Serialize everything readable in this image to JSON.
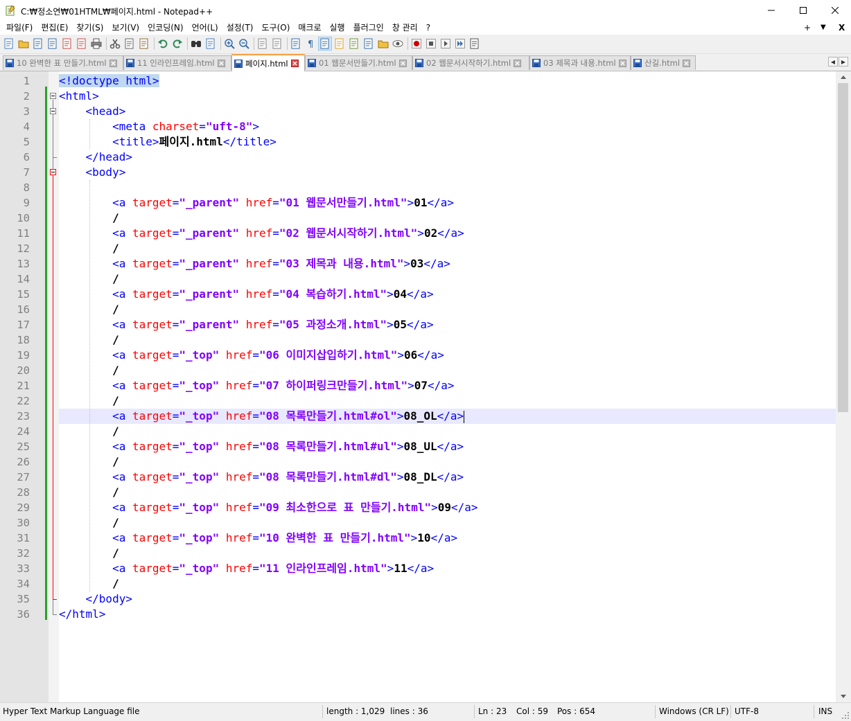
{
  "window": {
    "title": "C:₩정소연₩01HTML₩페이지.html - Notepad++",
    "icon": "notepad-icon"
  },
  "menu": {
    "items": [
      "파일(F)",
      "편집(E)",
      "찾기(S)",
      "보기(V)",
      "인코딩(N)",
      "언어(L)",
      "설정(T)",
      "도구(O)",
      "매크로",
      "실행",
      "플러그인",
      "창 관리",
      "?"
    ],
    "right_plus": "+",
    "right_arrow": "▼",
    "right_close": "X"
  },
  "toolbar": {
    "icons": [
      "new-file-icon",
      "open-file-icon",
      "save-icon",
      "save-all-icon",
      "close-icon",
      "close-all-icon",
      "print-icon",
      "cut-icon",
      "copy-icon",
      "paste-icon",
      "undo-icon",
      "redo-icon",
      "find-icon",
      "replace-icon",
      "zoom-in-icon",
      "zoom-out-icon",
      "sync-vertical-icon",
      "sync-horizontal-icon",
      "word-wrap-icon",
      "show-all-chars-icon",
      "indent-guide-icon",
      "language-icon",
      "doc-map-icon",
      "function-list-icon",
      "folder-as-workspace-icon",
      "monitoring-icon",
      "record-macro-icon",
      "stop-macro-icon",
      "play-macro-icon",
      "run-macro-multiple-icon",
      "save-macro-icon"
    ]
  },
  "tabs": [
    {
      "label": "10 완벽한 표 만들기.html",
      "active": false
    },
    {
      "label": "11 인라인프레임.html",
      "active": false
    },
    {
      "label": "페이지.html",
      "active": true
    },
    {
      "label": "01 웹문서만들기.html",
      "active": false
    },
    {
      "label": "02 웹문서시작하기.html",
      "active": false
    },
    {
      "label": "03 제목과 내용.html",
      "active": false
    },
    {
      "label": "산길.html",
      "active": false
    }
  ],
  "editor": {
    "current_line": 23,
    "lines": [
      [
        [
          "sel",
          "<!doctype html>"
        ]
      ],
      [
        [
          "tag",
          "<html>"
        ]
      ],
      [
        [
          "plain",
          "    "
        ],
        [
          "tag",
          "<head>"
        ]
      ],
      [
        [
          "plain",
          "        "
        ],
        [
          "tag",
          "<meta "
        ],
        [
          "attr",
          "charset"
        ],
        [
          "tag",
          "="
        ],
        [
          "val",
          "\"uft-8\""
        ],
        [
          "tag",
          ">"
        ]
      ],
      [
        [
          "plain",
          "        "
        ],
        [
          "tag",
          "<title>"
        ],
        [
          "text",
          "페이지.html"
        ],
        [
          "tag",
          "</title>"
        ]
      ],
      [
        [
          "plain",
          "    "
        ],
        [
          "tag",
          "</head>"
        ]
      ],
      [
        [
          "plain",
          "    "
        ],
        [
          "tag",
          "<body>"
        ]
      ],
      [
        [
          "plain",
          ""
        ]
      ],
      [
        [
          "plain",
          "        "
        ],
        [
          "tag",
          "<a "
        ],
        [
          "attr",
          "target"
        ],
        [
          "tag",
          "="
        ],
        [
          "val",
          "\"_parent\""
        ],
        [
          "tag",
          " "
        ],
        [
          "attr",
          "href"
        ],
        [
          "tag",
          "="
        ],
        [
          "val",
          "\"01 웹문서만들기.html\""
        ],
        [
          "tag",
          ">"
        ],
        [
          "text",
          "01"
        ],
        [
          "tag",
          "</a>"
        ]
      ],
      [
        [
          "plain",
          "        "
        ],
        [
          "text",
          "/"
        ]
      ],
      [
        [
          "plain",
          "        "
        ],
        [
          "tag",
          "<a "
        ],
        [
          "attr",
          "target"
        ],
        [
          "tag",
          "="
        ],
        [
          "val",
          "\"_parent\""
        ],
        [
          "tag",
          " "
        ],
        [
          "attr",
          "href"
        ],
        [
          "tag",
          "="
        ],
        [
          "val",
          "\"02 웹문서시작하기.html\""
        ],
        [
          "tag",
          ">"
        ],
        [
          "text",
          "02"
        ],
        [
          "tag",
          "</a>"
        ]
      ],
      [
        [
          "plain",
          "        "
        ],
        [
          "text",
          "/"
        ]
      ],
      [
        [
          "plain",
          "        "
        ],
        [
          "tag",
          "<a "
        ],
        [
          "attr",
          "target"
        ],
        [
          "tag",
          "="
        ],
        [
          "val",
          "\"_parent\""
        ],
        [
          "tag",
          " "
        ],
        [
          "attr",
          "href"
        ],
        [
          "tag",
          "="
        ],
        [
          "val",
          "\"03 제목과 내용.html\""
        ],
        [
          "tag",
          ">"
        ],
        [
          "text",
          "03"
        ],
        [
          "tag",
          "</a>"
        ]
      ],
      [
        [
          "plain",
          "        "
        ],
        [
          "text",
          "/"
        ]
      ],
      [
        [
          "plain",
          "        "
        ],
        [
          "tag",
          "<a "
        ],
        [
          "attr",
          "target"
        ],
        [
          "tag",
          "="
        ],
        [
          "val",
          "\"_parent\""
        ],
        [
          "tag",
          " "
        ],
        [
          "attr",
          "href"
        ],
        [
          "tag",
          "="
        ],
        [
          "val",
          "\"04 복습하기.html\""
        ],
        [
          "tag",
          ">"
        ],
        [
          "text",
          "04"
        ],
        [
          "tag",
          "</a>"
        ]
      ],
      [
        [
          "plain",
          "        "
        ],
        [
          "text",
          "/"
        ]
      ],
      [
        [
          "plain",
          "        "
        ],
        [
          "tag",
          "<a "
        ],
        [
          "attr",
          "target"
        ],
        [
          "tag",
          "="
        ],
        [
          "val",
          "\"_parent\""
        ],
        [
          "tag",
          " "
        ],
        [
          "attr",
          "href"
        ],
        [
          "tag",
          "="
        ],
        [
          "val",
          "\"05 과정소개.html\""
        ],
        [
          "tag",
          ">"
        ],
        [
          "text",
          "05"
        ],
        [
          "tag",
          "</a>"
        ]
      ],
      [
        [
          "plain",
          "        "
        ],
        [
          "text",
          "/"
        ]
      ],
      [
        [
          "plain",
          "        "
        ],
        [
          "tag",
          "<a "
        ],
        [
          "attr",
          "target"
        ],
        [
          "tag",
          "="
        ],
        [
          "val",
          "\"_top\""
        ],
        [
          "tag",
          " "
        ],
        [
          "attr",
          "href"
        ],
        [
          "tag",
          "="
        ],
        [
          "val",
          "\"06 이미지삽입하기.html\""
        ],
        [
          "tag",
          ">"
        ],
        [
          "text",
          "06"
        ],
        [
          "tag",
          "</a>"
        ]
      ],
      [
        [
          "plain",
          "        "
        ],
        [
          "text",
          "/"
        ]
      ],
      [
        [
          "plain",
          "        "
        ],
        [
          "tag",
          "<a "
        ],
        [
          "attr",
          "target"
        ],
        [
          "tag",
          "="
        ],
        [
          "val",
          "\"_top\""
        ],
        [
          "tag",
          " "
        ],
        [
          "attr",
          "href"
        ],
        [
          "tag",
          "="
        ],
        [
          "val",
          "\"07 하이퍼링크만들기.html\""
        ],
        [
          "tag",
          ">"
        ],
        [
          "text",
          "07"
        ],
        [
          "tag",
          "</a>"
        ]
      ],
      [
        [
          "plain",
          "        "
        ],
        [
          "text",
          "/"
        ]
      ],
      [
        [
          "plain",
          "        "
        ],
        [
          "tag",
          "<a "
        ],
        [
          "attr",
          "target"
        ],
        [
          "tag",
          "="
        ],
        [
          "val",
          "\"_top\""
        ],
        [
          "tag",
          " "
        ],
        [
          "attr",
          "href"
        ],
        [
          "tag",
          "="
        ],
        [
          "val",
          "\"08 목록만들기.html#ol\""
        ],
        [
          "tag",
          ">"
        ],
        [
          "text",
          "08_OL"
        ],
        [
          "tag",
          "</a>"
        ]
      ],
      [
        [
          "plain",
          "        "
        ],
        [
          "text",
          "/"
        ]
      ],
      [
        [
          "plain",
          "        "
        ],
        [
          "tag",
          "<a "
        ],
        [
          "attr",
          "target"
        ],
        [
          "tag",
          "="
        ],
        [
          "val",
          "\"_top\""
        ],
        [
          "tag",
          " "
        ],
        [
          "attr",
          "href"
        ],
        [
          "tag",
          "="
        ],
        [
          "val",
          "\"08 목록만들기.html#ul\""
        ],
        [
          "tag",
          ">"
        ],
        [
          "text",
          "08_UL"
        ],
        [
          "tag",
          "</a>"
        ]
      ],
      [
        [
          "plain",
          "        "
        ],
        [
          "text",
          "/"
        ]
      ],
      [
        [
          "plain",
          "        "
        ],
        [
          "tag",
          "<a "
        ],
        [
          "attr",
          "target"
        ],
        [
          "tag",
          "="
        ],
        [
          "val",
          "\"_top\""
        ],
        [
          "tag",
          " "
        ],
        [
          "attr",
          "href"
        ],
        [
          "tag",
          "="
        ],
        [
          "val",
          "\"08 목록만들기.html#dl\""
        ],
        [
          "tag",
          ">"
        ],
        [
          "text",
          "08_DL"
        ],
        [
          "tag",
          "</a>"
        ]
      ],
      [
        [
          "plain",
          "        "
        ],
        [
          "text",
          "/"
        ]
      ],
      [
        [
          "plain",
          "        "
        ],
        [
          "tag",
          "<a "
        ],
        [
          "attr",
          "target"
        ],
        [
          "tag",
          "="
        ],
        [
          "val",
          "\"_top\""
        ],
        [
          "tag",
          " "
        ],
        [
          "attr",
          "href"
        ],
        [
          "tag",
          "="
        ],
        [
          "val",
          "\"09 최소한으로 표 만들기.html\""
        ],
        [
          "tag",
          ">"
        ],
        [
          "text",
          "09"
        ],
        [
          "tag",
          "</a>"
        ]
      ],
      [
        [
          "plain",
          "        "
        ],
        [
          "text",
          "/"
        ]
      ],
      [
        [
          "plain",
          "        "
        ],
        [
          "tag",
          "<a "
        ],
        [
          "attr",
          "target"
        ],
        [
          "tag",
          "="
        ],
        [
          "val",
          "\"_top\""
        ],
        [
          "tag",
          " "
        ],
        [
          "attr",
          "href"
        ],
        [
          "tag",
          "="
        ],
        [
          "val",
          "\"10 완벽한 표 만들기.html\""
        ],
        [
          "tag",
          ">"
        ],
        [
          "text",
          "10"
        ],
        [
          "tag",
          "</a>"
        ]
      ],
      [
        [
          "plain",
          "        "
        ],
        [
          "text",
          "/"
        ]
      ],
      [
        [
          "plain",
          "        "
        ],
        [
          "tag",
          "<a "
        ],
        [
          "attr",
          "target"
        ],
        [
          "tag",
          "="
        ],
        [
          "val",
          "\"_top\""
        ],
        [
          "tag",
          " "
        ],
        [
          "attr",
          "href"
        ],
        [
          "tag",
          "="
        ],
        [
          "val",
          "\"11 인라인프레임.html\""
        ],
        [
          "tag",
          ">"
        ],
        [
          "text",
          "11"
        ],
        [
          "tag",
          "</a>"
        ]
      ],
      [
        [
          "plain",
          "        "
        ],
        [
          "text",
          "/"
        ]
      ],
      [
        [
          "plain",
          "    "
        ],
        [
          "tag",
          "</body>"
        ]
      ],
      [
        [
          "tag",
          "</html>"
        ]
      ]
    ]
  },
  "status": {
    "file_type": "Hyper Text Markup Language file",
    "length": "length : 1,029",
    "lines": "lines : 36",
    "ln": "Ln : 23",
    "col": "Col : 59",
    "pos": "Pos : 654",
    "eol": "Windows (CR LF)",
    "encoding": "UTF-8",
    "mode": "INS"
  },
  "colors": {
    "tag": "#0000ff",
    "attr": "#ff0000",
    "value": "#8000ff",
    "current_line": "#e8e8ff",
    "active_tab_accent": "#f5a142"
  }
}
